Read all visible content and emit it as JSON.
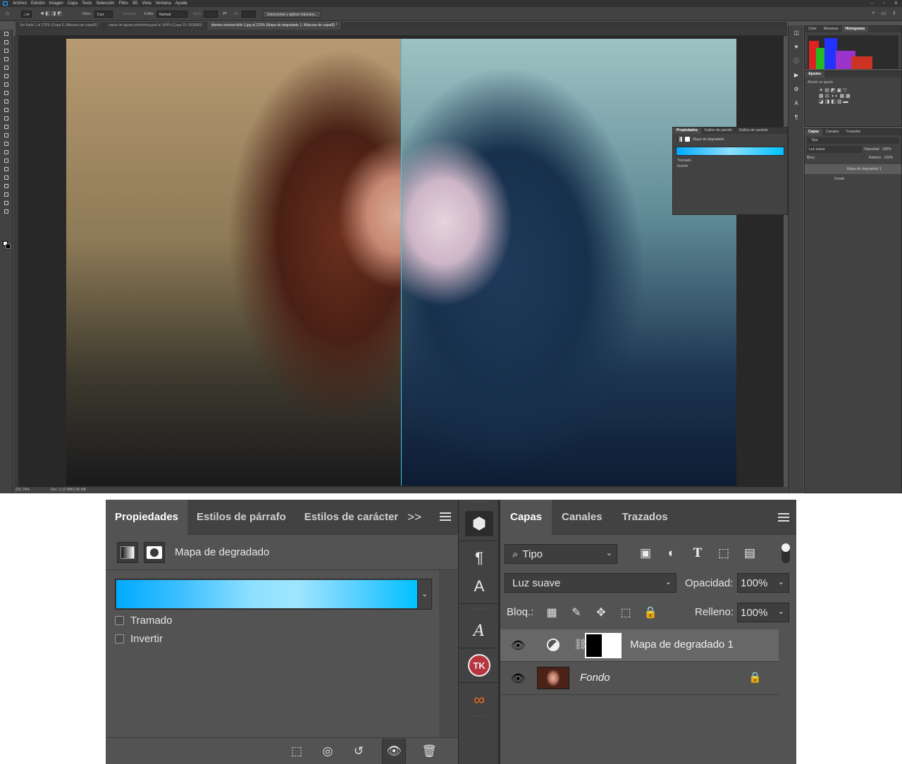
{
  "menubar": {
    "items": [
      "Archivo",
      "Edición",
      "Imagen",
      "Capa",
      "Texto",
      "Selección",
      "Filtro",
      "3D",
      "Vista",
      "Ventana",
      "Ayuda"
    ]
  },
  "options_bar": {
    "feather_label": "Desv.:",
    "feather_value": "0 px",
    "antialias_label": "Suavizar",
    "style_label": "Estilo:",
    "style_value": "Normal",
    "width_label": "Anch.:",
    "height_label": "Alt.:",
    "mask_button": "Seleccionar y aplicar máscara..."
  },
  "doc_tabs": [
    {
      "label": "Sin título-1 al 276% (Capa 6, Máscara de capa/8) *",
      "active": false
    },
    {
      "label": "capas de ajuste photoshop.psd al 164% (Capa 29, RGB/8#)",
      "active": false
    },
    {
      "label": "dientes-sonrisa-feliz-1.jpg al 223% (Mapa de degradado 1, Máscara de capa/8) *",
      "active": true
    }
  ],
  "status": {
    "zoom": "222,74%",
    "doc": "Doc: 3,12 MB/3,96 MB"
  },
  "mini_panels": {
    "color_tabs": [
      "Color",
      "Muestras",
      "Histograma"
    ],
    "adjust_tabs": [
      "Ajustes"
    ],
    "adjust_hint": "Añadir un ajuste",
    "layers_tabs": [
      "Capas",
      "Canales",
      "Trazados"
    ],
    "props_tabs": [
      "Propiedades",
      "Estilos de párrafo",
      "Estilos de carácter"
    ],
    "props_title": "Mapa de degradado",
    "props_options": [
      "Tramado",
      "Invertir"
    ],
    "layers_kind": "Tipo",
    "layers_blend": "Luz suave",
    "layers_opacity_label": "Opacidad:",
    "layers_opacity": "100%",
    "layers_lock_label": "Bloq.:",
    "layers_fill_label": "Relleno:",
    "layers_fill": "100%",
    "layer_names": [
      "Mapa de degradado 1",
      "Fondo"
    ]
  },
  "properties": {
    "tabs": [
      "Propiedades",
      "Estilos de párrafo",
      "Estilos de carácter"
    ],
    "more": ">>",
    "title": "Mapa de degradado",
    "gradient_colors": [
      "#00aaff",
      "#8ee0ff",
      "#00c1ff"
    ],
    "dither_label": "Tramado",
    "reverse_label": "Invertir",
    "dither": false,
    "reverse": false
  },
  "dock_icons": [
    "3d-icon",
    "paragraph-icon",
    "character-icon",
    "glyph-icon",
    "tk-plugin-icon",
    "infinity-plugin-icon"
  ],
  "layers": {
    "tabs": [
      "Capas",
      "Canales",
      "Trazados"
    ],
    "kind": "Tipo",
    "blend_mode": "Luz suave",
    "opacity_label": "Opacidad:",
    "opacity": "100%",
    "lock_label": "Bloq.:",
    "fill_label": "Relleno:",
    "fill": "100%",
    "items": [
      {
        "name": "Mapa de degradado 1",
        "visible": true,
        "active": true
      },
      {
        "name": "Fondo",
        "visible": true,
        "locked": true
      }
    ]
  },
  "colors": {
    "ui_dark": "#424242",
    "ui_mid": "#535353",
    "accent_guide": "#3fc7e8",
    "gradient_start": "#00aaff",
    "gradient_end": "#00c1ff"
  }
}
